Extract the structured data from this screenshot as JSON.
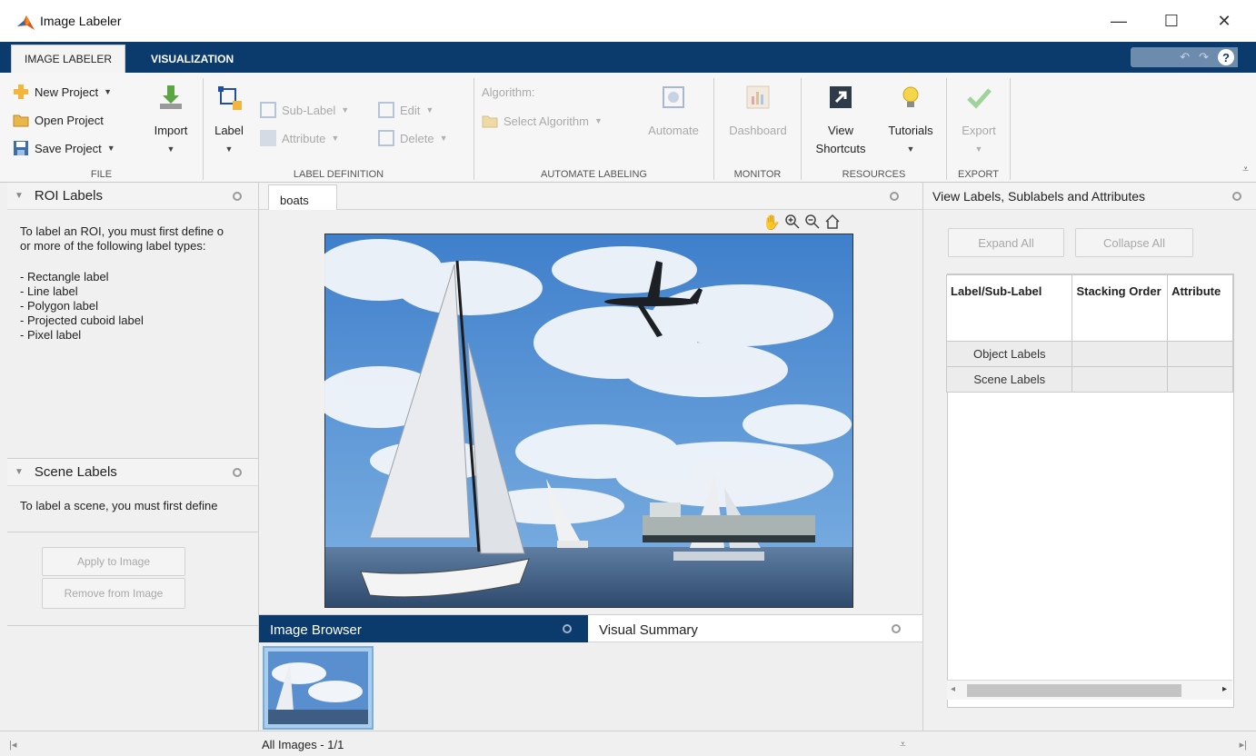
{
  "window": {
    "title": "Image Labeler",
    "controls": [
      "—",
      "☐",
      "✕"
    ]
  },
  "ribbon": {
    "tabs": [
      {
        "label": "IMAGE LABELER",
        "active": true
      },
      {
        "label": "VISUALIZATION",
        "active": false
      }
    ],
    "quick_access": {
      "undo": "↶",
      "redo": "↷",
      "help": "?"
    },
    "sections": {
      "file": {
        "title": "FILE",
        "new_project": "New Project",
        "open_project": "Open Project",
        "save_project": "Save Project",
        "import": "Import"
      },
      "label_definition": {
        "title": "LABEL DEFINITION",
        "label": "Label",
        "sub_label": "Sub-Label",
        "attribute": "Attribute",
        "edit": "Edit",
        "delete": "Delete"
      },
      "automate_labeling": {
        "title": "AUTOMATE LABELING",
        "algorithm_label": "Algorithm:",
        "select_algorithm": "Select Algorithm",
        "automate": "Automate"
      },
      "monitor": {
        "title": "MONITOR",
        "dashboard": "Dashboard"
      },
      "resources": {
        "title": "RESOURCES",
        "view_shortcuts_line1": "View",
        "view_shortcuts_line2": "Shortcuts",
        "tutorials": "Tutorials"
      },
      "export": {
        "title": "EXPORT",
        "export": "Export"
      }
    }
  },
  "roi_panel": {
    "title": "ROI Labels",
    "intro_line1": "To label an ROI, you must first define o",
    "intro_line2": "or more of the following label types:",
    "types": [
      "- Rectangle label",
      "- Line label",
      "- Polygon label",
      "- Projected cuboid label",
      "- Pixel label"
    ]
  },
  "scene_panel": {
    "title": "Scene Labels",
    "intro": "To label a scene, you must first define",
    "apply_button": "Apply to Image",
    "remove_button": "Remove from Image"
  },
  "image_panel": {
    "tab": "boats",
    "toolbar_icons": [
      "pan-icon",
      "zoom-in-icon",
      "zoom-out-icon",
      "home-icon"
    ]
  },
  "browser": {
    "tab_active": "Image Browser",
    "tab_inactive": "Visual Summary",
    "status": "All Images - 1/1"
  },
  "right_panel": {
    "title": "View Labels, Sublabels and Attributes",
    "expand_all": "Expand All",
    "collapse_all": "Collapse All",
    "columns": [
      "Label/Sub-Label",
      "Stacking Order",
      "Attribute"
    ],
    "rows": [
      "Object Labels",
      "Scene Labels"
    ]
  },
  "colors": {
    "tabstrip": "#0b3b6c",
    "active_panel_tab": "#0b3b6c",
    "sky": "#4a88cf"
  }
}
